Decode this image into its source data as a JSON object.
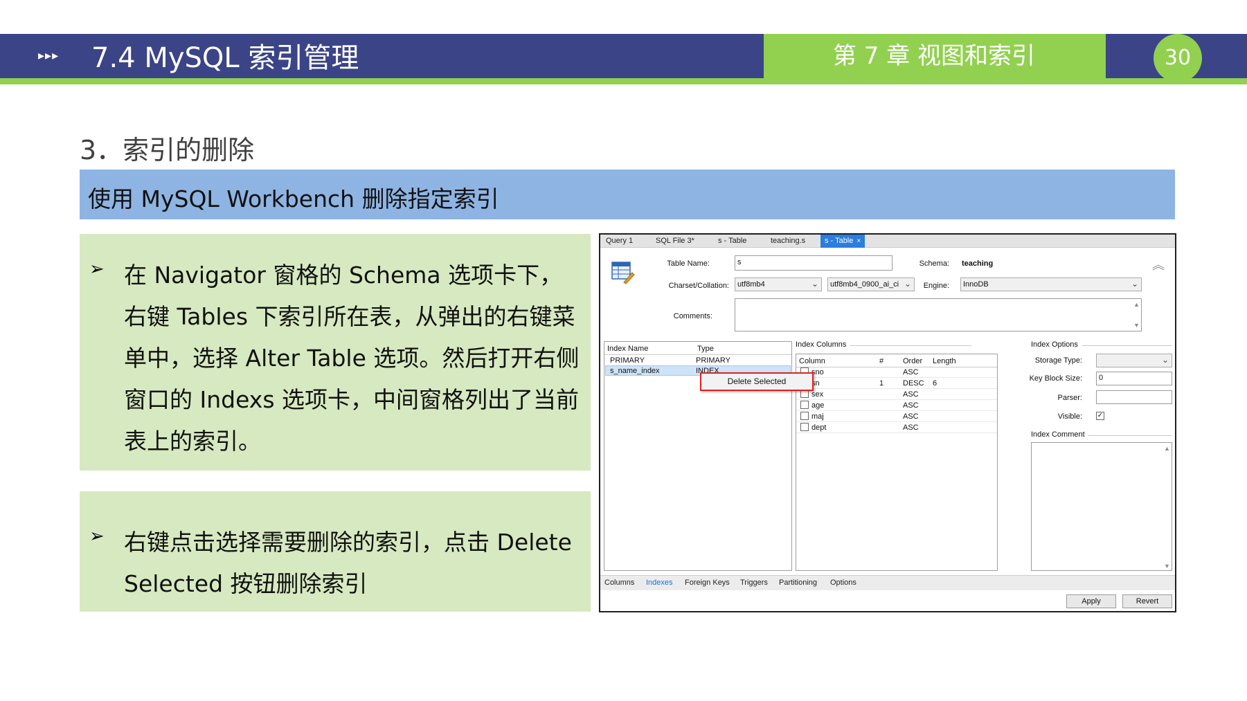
{
  "header": {
    "arrows": "▸▸▸",
    "title": "7.4  MySQL 索引管理",
    "chapter": "第 7 章  视图和索引",
    "page_number": "30"
  },
  "section_title": "3．索引的删除",
  "subtitle": "使用 MySQL Workbench 删除指定索引",
  "bullets": [
    {
      "symbol": "➢",
      "text": "在 Navigator 窗格的 Schema 选项卡下，右键 Tables 下索引所在表，从弹出的右键菜单中，选择 Alter Table 选项。然后打开右侧窗口的 Indexs 选项卡，中间窗格列出了当前表上的索引。"
    },
    {
      "symbol": "➢",
      "text": "右键点击选择需要删除的索引，点击 Delete Selected 按钮删除索引"
    }
  ],
  "workbench": {
    "tabs": [
      "Query 1",
      "SQL File 3*",
      "s - Table",
      "teaching.s",
      "s - Table"
    ],
    "active_tab_close": "×",
    "table_name_label": "Table Name:",
    "table_name_value": "s",
    "schema_label": "Schema:",
    "schema_value": "teaching",
    "charset_label": "Charset/Collation:",
    "charset_value": "utf8mb4",
    "collation_value": "utf8mb4_0900_ai_ci",
    "engine_label": "Engine:",
    "engine_value": "InnoDB",
    "comments_label": "Comments:",
    "index_list": {
      "headers": [
        "Index Name",
        "Type"
      ],
      "rows": [
        {
          "name": "PRIMARY",
          "type": "PRIMARY"
        },
        {
          "name": "s_name_index",
          "type": "INDEX"
        }
      ]
    },
    "context_menu_item": "Delete Selected",
    "index_columns": {
      "title": "Index Columns",
      "headers": [
        "Column",
        "#",
        "Order",
        "Length"
      ],
      "rows": [
        {
          "column": "sno",
          "num": "",
          "order": "ASC",
          "length": "",
          "checked": false
        },
        {
          "column": "sn",
          "num": "1",
          "order": "DESC",
          "length": "6",
          "checked": true
        },
        {
          "column": "sex",
          "num": "",
          "order": "ASC",
          "length": "",
          "checked": false
        },
        {
          "column": "age",
          "num": "",
          "order": "ASC",
          "length": "",
          "checked": false
        },
        {
          "column": "maj",
          "num": "",
          "order": "ASC",
          "length": "",
          "checked": false
        },
        {
          "column": "dept",
          "num": "",
          "order": "ASC",
          "length": "",
          "checked": false
        }
      ]
    },
    "index_options": {
      "title": "Index Options",
      "storage_type_label": "Storage Type:",
      "key_block_size_label": "Key Block Size:",
      "key_block_size_value": "0",
      "parser_label": "Parser:",
      "visible_label": "Visible:",
      "visible_checked": "✓",
      "index_comment_label": "Index Comment"
    },
    "bottom_tabs": [
      "Columns",
      "Indexes",
      "Foreign Keys",
      "Triggers",
      "Partitioning",
      "Options"
    ],
    "apply_label": "Apply",
    "revert_label": "Revert"
  }
}
